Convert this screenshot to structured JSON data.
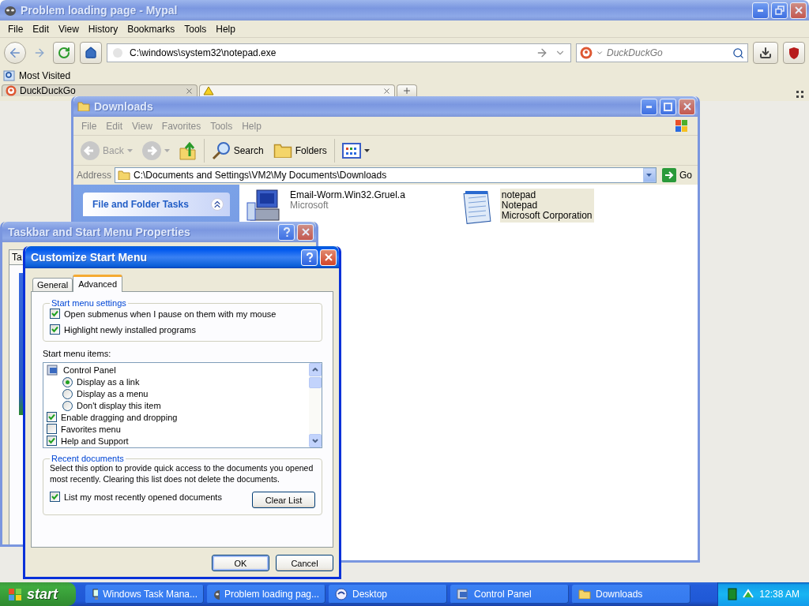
{
  "browser": {
    "active": false,
    "title": "Problem loading page - Mypal",
    "menu": [
      "File",
      "Edit",
      "View",
      "History",
      "Bookmarks",
      "Tools",
      "Help"
    ],
    "address": "C:\\windows\\system32\\notepad.exe",
    "search": {
      "placeholder": "DuckDuckGo"
    },
    "bookmarks": [
      "Most Visited"
    ],
    "tabs": [
      {
        "label": "DuckDuckGo",
        "selected": false
      },
      {
        "selected": true
      }
    ]
  },
  "explorer": {
    "active": false,
    "title": "Downloads",
    "menu": [
      "File",
      "Edit",
      "View",
      "Favorites",
      "Tools",
      "Help"
    ],
    "toolbar": {
      "back": "Back",
      "search": "Search",
      "folders": "Folders"
    },
    "address_label": "Address",
    "address": "C:\\Documents and Settings\\VM2\\My Documents\\Downloads",
    "go": "Go",
    "task_pane": {
      "title": "File and Folder Tasks"
    },
    "files": [
      {
        "kind": "program",
        "name": "Email-Worm.Win32.Gruel.a",
        "company": "Microsoft",
        "selected": false
      },
      {
        "kind": "notepad",
        "name": "notepad",
        "description": "Notepad",
        "company": "Microsoft Corporation",
        "selected": true
      }
    ]
  },
  "taskbar_properties": {
    "active": false,
    "title": "Taskbar and Start Menu Properties",
    "tab": "Ta"
  },
  "customize": {
    "active": true,
    "title": "Customize Start Menu",
    "tabs": [
      {
        "label": "General",
        "selected": false
      },
      {
        "label": "Advanced",
        "selected": true
      }
    ],
    "settings_group": {
      "title": "Start menu settings",
      "options": [
        {
          "label": "Open submenus when I pause on them with my mouse",
          "checked": true
        },
        {
          "label": "Highlight newly installed programs",
          "checked": true
        }
      ]
    },
    "items_label": "Start menu items:",
    "items": [
      {
        "kind": "heading",
        "label": "Control Panel",
        "children": [
          {
            "kind": "radio",
            "label": "Display as a link",
            "selected": true
          },
          {
            "kind": "radio",
            "label": "Display as a menu",
            "selected": false
          },
          {
            "kind": "radio",
            "label": "Don't display this item",
            "selected": false
          }
        ]
      },
      {
        "kind": "checkbox",
        "label": "Enable dragging and dropping",
        "checked": true
      },
      {
        "kind": "checkbox",
        "label": "Favorites menu",
        "checked": false
      },
      {
        "kind": "checkbox",
        "label": "Help and Support",
        "checked": true
      }
    ],
    "recent_group": {
      "title": "Recent documents",
      "description": "Select this option to provide quick access to the documents you opened most recently. Clearing this list does not delete the documents.",
      "option": {
        "label": "List my most recently opened documents",
        "checked": true
      },
      "clear_button": "Clear List"
    },
    "buttons": [
      "OK",
      "Cancel"
    ]
  },
  "taskbar": {
    "start": "start",
    "buttons": [
      {
        "kind": "taskmgr",
        "label": "Windows Task Mana...",
        "selected": false
      },
      {
        "kind": "browser",
        "label": "Problem loading pag...",
        "selected": false
      },
      {
        "kind": "desktop",
        "label": "Desktop",
        "selected": false
      },
      {
        "kind": "control",
        "label": "Control Panel",
        "selected": false
      },
      {
        "kind": "folder",
        "label": "Downloads",
        "selected": false
      }
    ],
    "clock": "12:38 AM"
  }
}
